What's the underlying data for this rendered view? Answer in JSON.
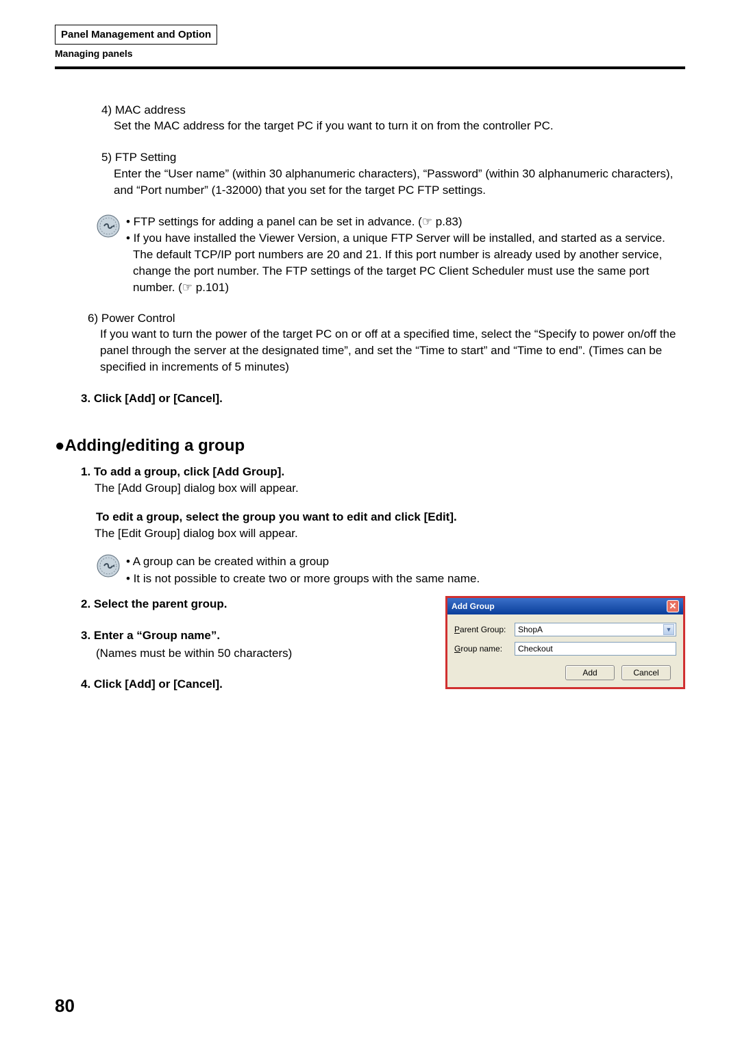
{
  "header": {
    "title": "Panel Management and Option",
    "subtitle": "Managing panels"
  },
  "items": {
    "i4": {
      "num": "4)",
      "title": "MAC address",
      "desc": "Set the MAC address for the target PC if you want to turn it on from the controller PC."
    },
    "i5": {
      "num": "5)",
      "title": "FTP Setting",
      "desc": "Enter the “User name” (within 30 alphanumeric characters), “Password” (within 30 alphanumeric characters), and “Port number” (1-32000) that you set for the target PC FTP settings."
    },
    "note1": {
      "b1": "• FTP settings for adding a panel can be set in advance. (☞ p.83)",
      "b2": "• If you have installed the Viewer Version, a unique FTP Server will be installed, and started as a service. The default TCP/IP port numbers are 20 and 21. If this port number is already used by another service, change the port number.  The FTP settings of the target PC Client Scheduler must use the same port number. (☞ p.101)"
    },
    "i6": {
      "num": "6)",
      "title": "Power Control",
      "desc": "If you want to turn the power of the target PC on or off at a specified time, select the “Specify to power on/off the panel through the server at the designated time”, and set the “Time to start” and “Time to end”. (Times can be specified in increments of 5 minutes)"
    }
  },
  "step3": "3.   Click [Add] or [Cancel].",
  "section": {
    "title": "●Adding/editing a group",
    "s1": {
      "bold": "1.   To add a group, click [Add Group].",
      "body": "The [Add Group] dialog box will appear."
    },
    "s1b": {
      "bold": "To edit a group, select the group you want to edit and click [Edit].",
      "body": "The [Edit Group] dialog box will appear."
    },
    "note2": {
      "b1": "• A group can be created within a group",
      "b2": "• It is not possible to create two or more groups with the same name."
    },
    "s2": "2.   Select the parent group.",
    "s3": {
      "bold": "3.   Enter a “Group name”.",
      "body": "(Names must be within 50 characters)"
    },
    "s4": "4.   Click [Add] or [Cancel]."
  },
  "dialog": {
    "title": "Add Group",
    "parent_label": "Parent Group:",
    "parent_value": "ShopA",
    "name_label": "Group name:",
    "name_value": "Checkout",
    "add": "Add",
    "cancel": "Cancel"
  },
  "page_number": "80"
}
